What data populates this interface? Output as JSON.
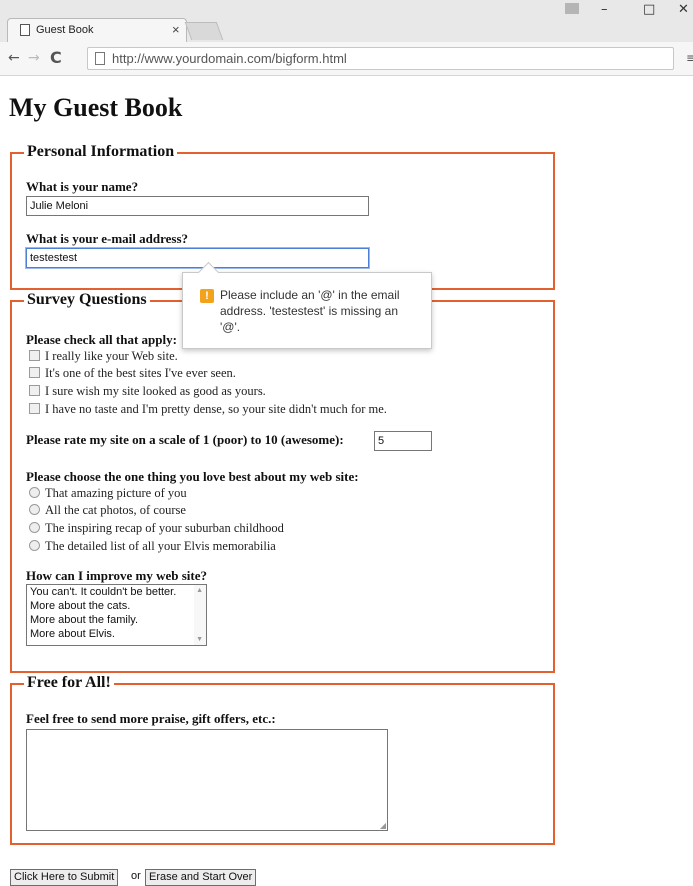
{
  "browser": {
    "tab_title": "Guest Book",
    "tab_close": "×",
    "url": "http://www.yourdomain.com/bigform.html",
    "window": {
      "minimize": "–",
      "maximize": "□",
      "close": "✕"
    },
    "icons": {
      "back": "arrow-left-icon",
      "forward": "arrow-right-icon",
      "reload": "reload-icon",
      "menu": "hamburger-menu-icon",
      "page": "page-icon"
    }
  },
  "page": {
    "title": "My Guest Book"
  },
  "personal": {
    "legend": "Personal Information",
    "name_label": "What is your name?",
    "name_value": "Julie Meloni",
    "email_label": "What is your e-mail address?",
    "email_value": "testestest"
  },
  "survey": {
    "legend": "Survey Questions",
    "check_label": "Please check all that apply:",
    "checkboxes": [
      "I really like your Web site.",
      "It's one of the best sites I've ever seen.",
      "I sure wish my site looked as good as yours.",
      "I have no taste and I'm pretty dense, so your site didn't much for me."
    ],
    "rate_label": "Please rate my site on a scale of 1 (poor) to 10 (awesome):",
    "rate_value": "5",
    "choose_label": "Please choose the one thing you love best about my web site:",
    "radios": [
      "That amazing picture of you",
      "All the cat photos, of course",
      "The inspiring recap of your suburban childhood",
      "The detailed list of all your Elvis memorabilia"
    ],
    "improve_label": "How can I improve my web site?",
    "improve_options": [
      "You can't. It couldn't be better.",
      "More about the cats.",
      "More about the family.",
      "More about Elvis."
    ]
  },
  "free": {
    "legend": "Free for All!",
    "label": "Feel free to send more praise, gift offers, etc.:",
    "value": ""
  },
  "actions": {
    "submit": "Click Here to Submit",
    "or": "or",
    "reset": "Erase and Start Over"
  },
  "validation": {
    "icon": "!",
    "message": "Please include an '@' in the email address. 'testestest' is missing an '@'."
  },
  "colors": {
    "fieldset_border": "#e2612f",
    "focus_border": "#4d7fd6",
    "warning": "#f3a21c"
  }
}
